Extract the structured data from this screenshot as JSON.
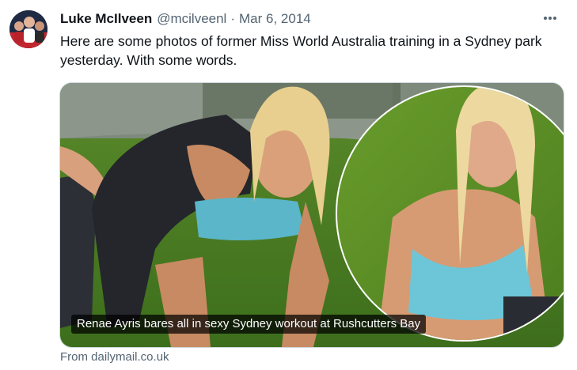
{
  "author": {
    "name": "Luke McIlveen",
    "handle": "@mcilveenl",
    "separator": "·",
    "date": "Mar 6, 2014"
  },
  "tweet": {
    "text": "Here are some photos of former Miss World Australia training in a Sydney park yesterday. With some words."
  },
  "media": {
    "caption": "Renae Ayris bares all in sexy Sydney workout at Rushcutters Bay"
  },
  "card": {
    "source": "From dailymail.co.uk"
  },
  "icons": {
    "more": "more-horizontal-icon",
    "avatar": "avatar-photo"
  }
}
